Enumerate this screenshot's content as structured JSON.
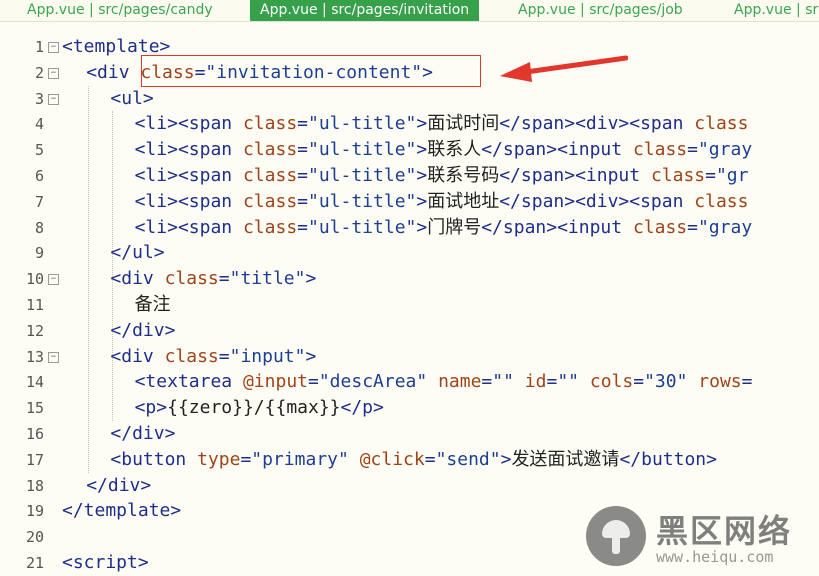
{
  "tabs": [
    {
      "label": "App.vue | src/pages/candy",
      "active": false
    },
    {
      "label": "App.vue | src/pages/invitation",
      "active": true
    },
    {
      "label": "App.vue | src/pages/job",
      "active": false
    },
    {
      "label": "App.vue | sr",
      "active": false
    }
  ],
  "lines": [
    {
      "num": "1",
      "fold": true,
      "indent": 0,
      "tokens": [
        [
          "tag",
          "<template>"
        ]
      ]
    },
    {
      "num": "2",
      "fold": true,
      "indent": 1,
      "tokens": [
        [
          "tag",
          "<div "
        ],
        [
          "attr",
          "class"
        ],
        [
          "punc",
          "="
        ],
        [
          "str",
          "\"invitation-content\""
        ],
        [
          "tag",
          ">"
        ]
      ]
    },
    {
      "num": "3",
      "fold": true,
      "indent": 2,
      "tokens": [
        [
          "tag",
          "<ul>"
        ]
      ]
    },
    {
      "num": "4",
      "fold": false,
      "indent": 3,
      "tokens": [
        [
          "tag",
          "<li><span "
        ],
        [
          "attr",
          "class"
        ],
        [
          "punc",
          "="
        ],
        [
          "str",
          "\"ul-title\""
        ],
        [
          "tag",
          ">"
        ],
        [
          "txt",
          "面试时间"
        ],
        [
          "tag",
          "</span><div><span "
        ],
        [
          "attr",
          "class"
        ]
      ]
    },
    {
      "num": "5",
      "fold": false,
      "indent": 3,
      "tokens": [
        [
          "tag",
          "<li><span "
        ],
        [
          "attr",
          "class"
        ],
        [
          "punc",
          "="
        ],
        [
          "str",
          "\"ul-title\""
        ],
        [
          "tag",
          ">"
        ],
        [
          "txt",
          "联系人"
        ],
        [
          "tag",
          "</span><input "
        ],
        [
          "attr",
          "class"
        ],
        [
          "punc",
          "="
        ],
        [
          "str",
          "\"gray"
        ]
      ]
    },
    {
      "num": "6",
      "fold": false,
      "indent": 3,
      "tokens": [
        [
          "tag",
          "<li><span "
        ],
        [
          "attr",
          "class"
        ],
        [
          "punc",
          "="
        ],
        [
          "str",
          "\"ul-title\""
        ],
        [
          "tag",
          ">"
        ],
        [
          "txt",
          "联系号码"
        ],
        [
          "tag",
          "</span><input "
        ],
        [
          "attr",
          "class"
        ],
        [
          "punc",
          "="
        ],
        [
          "str",
          "\"gr"
        ]
      ]
    },
    {
      "num": "7",
      "fold": false,
      "indent": 3,
      "tokens": [
        [
          "tag",
          "<li><span "
        ],
        [
          "attr",
          "class"
        ],
        [
          "punc",
          "="
        ],
        [
          "str",
          "\"ul-title\""
        ],
        [
          "tag",
          ">"
        ],
        [
          "txt",
          "面试地址"
        ],
        [
          "tag",
          "</span><div><span "
        ],
        [
          "attr",
          "class"
        ]
      ]
    },
    {
      "num": "8",
      "fold": false,
      "indent": 3,
      "tokens": [
        [
          "tag",
          "<li><span "
        ],
        [
          "attr",
          "class"
        ],
        [
          "punc",
          "="
        ],
        [
          "str",
          "\"ul-title\""
        ],
        [
          "tag",
          ">"
        ],
        [
          "txt",
          "门牌号"
        ],
        [
          "tag",
          "</span><input "
        ],
        [
          "attr",
          "class"
        ],
        [
          "punc",
          "="
        ],
        [
          "str",
          "\"gray"
        ]
      ]
    },
    {
      "num": "9",
      "fold": false,
      "indent": 2,
      "tokens": [
        [
          "tag",
          "</ul>"
        ]
      ]
    },
    {
      "num": "10",
      "fold": true,
      "indent": 2,
      "tokens": [
        [
          "tag",
          "<div "
        ],
        [
          "attr",
          "class"
        ],
        [
          "punc",
          "="
        ],
        [
          "str",
          "\"title\""
        ],
        [
          "tag",
          ">"
        ]
      ]
    },
    {
      "num": "11",
      "fold": false,
      "indent": 3,
      "tokens": [
        [
          "txt",
          "备注"
        ]
      ]
    },
    {
      "num": "12",
      "fold": false,
      "indent": 2,
      "tokens": [
        [
          "tag",
          "</div>"
        ]
      ]
    },
    {
      "num": "13",
      "fold": true,
      "indent": 2,
      "tokens": [
        [
          "tag",
          "<div "
        ],
        [
          "attr",
          "class"
        ],
        [
          "punc",
          "="
        ],
        [
          "str",
          "\"input\""
        ],
        [
          "tag",
          ">"
        ]
      ]
    },
    {
      "num": "14",
      "fold": false,
      "indent": 3,
      "tokens": [
        [
          "tag",
          "<textarea "
        ],
        [
          "attr",
          "@input"
        ],
        [
          "punc",
          "="
        ],
        [
          "str",
          "\"descArea\""
        ],
        [
          "txt",
          " "
        ],
        [
          "attr",
          "name"
        ],
        [
          "punc",
          "="
        ],
        [
          "str",
          "\"\""
        ],
        [
          "txt",
          " "
        ],
        [
          "attr",
          "id"
        ],
        [
          "punc",
          "="
        ],
        [
          "str",
          "\"\""
        ],
        [
          "txt",
          " "
        ],
        [
          "attr",
          "cols"
        ],
        [
          "punc",
          "="
        ],
        [
          "str",
          "\"30\""
        ],
        [
          "txt",
          " "
        ],
        [
          "attr",
          "rows"
        ],
        [
          "punc",
          "="
        ]
      ]
    },
    {
      "num": "15",
      "fold": false,
      "indent": 3,
      "tokens": [
        [
          "tag",
          "<p>"
        ],
        [
          "txt",
          "{{zero}}/{{max}}"
        ],
        [
          "tag",
          "</p>"
        ]
      ]
    },
    {
      "num": "16",
      "fold": false,
      "indent": 2,
      "tokens": [
        [
          "tag",
          "</div>"
        ]
      ]
    },
    {
      "num": "17",
      "fold": false,
      "indent": 2,
      "tokens": [
        [
          "tag",
          "<button "
        ],
        [
          "attr",
          "type"
        ],
        [
          "punc",
          "="
        ],
        [
          "str",
          "\"primary\""
        ],
        [
          "txt",
          " "
        ],
        [
          "attr",
          "@click"
        ],
        [
          "punc",
          "="
        ],
        [
          "str",
          "\"send\""
        ],
        [
          "tag",
          ">"
        ],
        [
          "txt",
          "发送面试邀请"
        ],
        [
          "tag",
          "</button>"
        ]
      ]
    },
    {
      "num": "18",
      "fold": false,
      "indent": 1,
      "tokens": [
        [
          "tag",
          "</div>"
        ]
      ]
    },
    {
      "num": "19",
      "fold": false,
      "indent": 0,
      "tokens": [
        [
          "tag",
          "</template>"
        ]
      ]
    },
    {
      "num": "20",
      "fold": false,
      "indent": 0,
      "tokens": []
    },
    {
      "num": "21",
      "fold": false,
      "indent": 0,
      "tokens": [
        [
          "tag",
          "<script>"
        ]
      ]
    }
  ],
  "colors": {
    "accent": "#37a04a",
    "annotation": "#e3362d"
  },
  "watermark": {
    "title": "黑区网络",
    "url": "www.heiqu.com"
  }
}
